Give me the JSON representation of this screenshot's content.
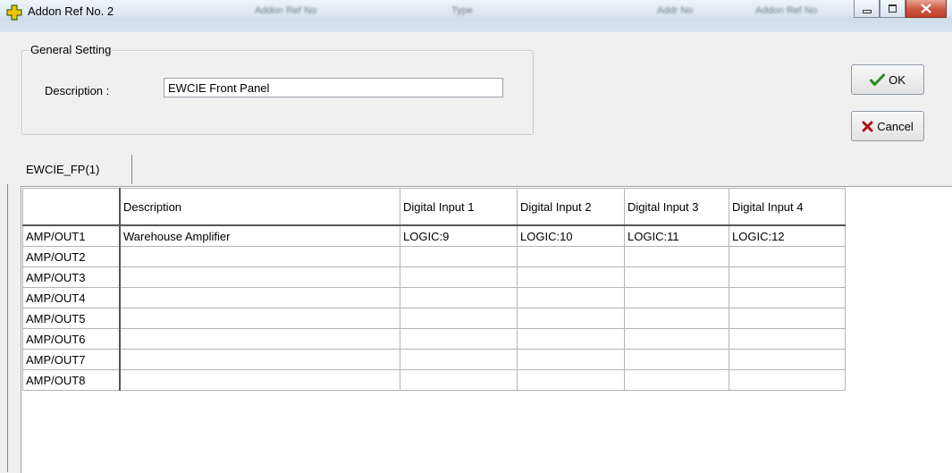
{
  "window": {
    "title": "Addon Ref No. 2",
    "background_titles": [
      "Addon Ref No",
      "Type",
      "Addr No",
      "Addon Ref No"
    ]
  },
  "general": {
    "legend": "General Setting",
    "description_label": "Description :",
    "description_value": "EWCIE Front Panel"
  },
  "buttons": {
    "ok": "OK",
    "cancel": "Cancel"
  },
  "tab": {
    "label": "EWCIE_FP(1)"
  },
  "grid": {
    "columns": [
      "",
      "Description",
      "Digital Input 1",
      "Digital Input 2",
      "Digital Input 3",
      "Digital Input 4"
    ],
    "rows": [
      [
        "AMP/OUT1",
        "Warehouse Amplifier",
        "LOGIC:9",
        "LOGIC:10",
        "LOGIC:11",
        "LOGIC:12"
      ],
      [
        "AMP/OUT2",
        "",
        "",
        "",
        "",
        ""
      ],
      [
        "AMP/OUT3",
        "",
        "",
        "",
        "",
        ""
      ],
      [
        "AMP/OUT4",
        "",
        "",
        "",
        "",
        ""
      ],
      [
        "AMP/OUT5",
        "",
        "",
        "",
        "",
        ""
      ],
      [
        "AMP/OUT6",
        "",
        "",
        "",
        "",
        ""
      ],
      [
        "AMP/OUT7",
        "",
        "",
        "",
        "",
        ""
      ],
      [
        "AMP/OUT8",
        "",
        "",
        "",
        "",
        ""
      ]
    ]
  },
  "icons": {
    "app": "plus-icon",
    "ok": "checkmark-icon",
    "cancel": "x-icon"
  },
  "colors": {
    "app_icon": "#f2c400",
    "ok_check": "#2a8a1e",
    "cancel_x": "#b01010",
    "close_btn": "#c9432c"
  }
}
